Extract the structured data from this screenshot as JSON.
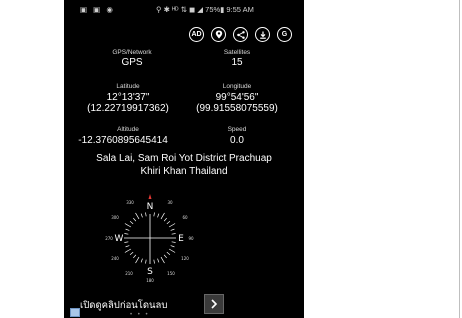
{
  "status_bar": {
    "left_icons": "▣ ▣ ◉",
    "right_text": "⚲ ✱ ᴴᴰ ⇅ ◼ ◢ 75%▮ 9:55 AM"
  },
  "actions": {
    "ad_label": "AD",
    "share_icon": "share-icon",
    "location_icon": "map-pin-icon",
    "download_icon": "download-icon",
    "g_label": "G"
  },
  "gps": {
    "label": "GPS/Network",
    "value": "GPS"
  },
  "satellites": {
    "label": "Satellites",
    "value": "15"
  },
  "latitude": {
    "label": "Latitude",
    "dms": "12°13'37\"",
    "decimal": "(12.22719917362)"
  },
  "longitude": {
    "label": "Longitude",
    "dms": "99°54'56\"",
    "decimal": "(99.91558075559)"
  },
  "altitude": {
    "label": "Altitude",
    "value": "-12.3760895645414"
  },
  "speed": {
    "label": "Speed",
    "value": "0.0"
  },
  "address": {
    "line1": "Sala Lai, Sam Roi Yot District Prachuap",
    "line2": "Khiri Khan Thailand"
  },
  "compass": {
    "north": "N",
    "south": "S",
    "east": "E",
    "west": "W",
    "deg_30": "30",
    "deg_60": "60",
    "deg_120": "120",
    "deg_150": "150",
    "deg_210": "210",
    "deg_240": "240",
    "deg_300": "300",
    "deg_330": "330",
    "deg_180": "180",
    "deg_90": "90",
    "deg_270": "270",
    "colors": {
      "north_marker": "#e53935",
      "ring": "#ffffff"
    }
  },
  "bottom": {
    "ad_text": "เปิดดูคลิปก่อนโดนลบ",
    "next_icon": "chevron-right-icon",
    "pager_dots": "• • •"
  }
}
